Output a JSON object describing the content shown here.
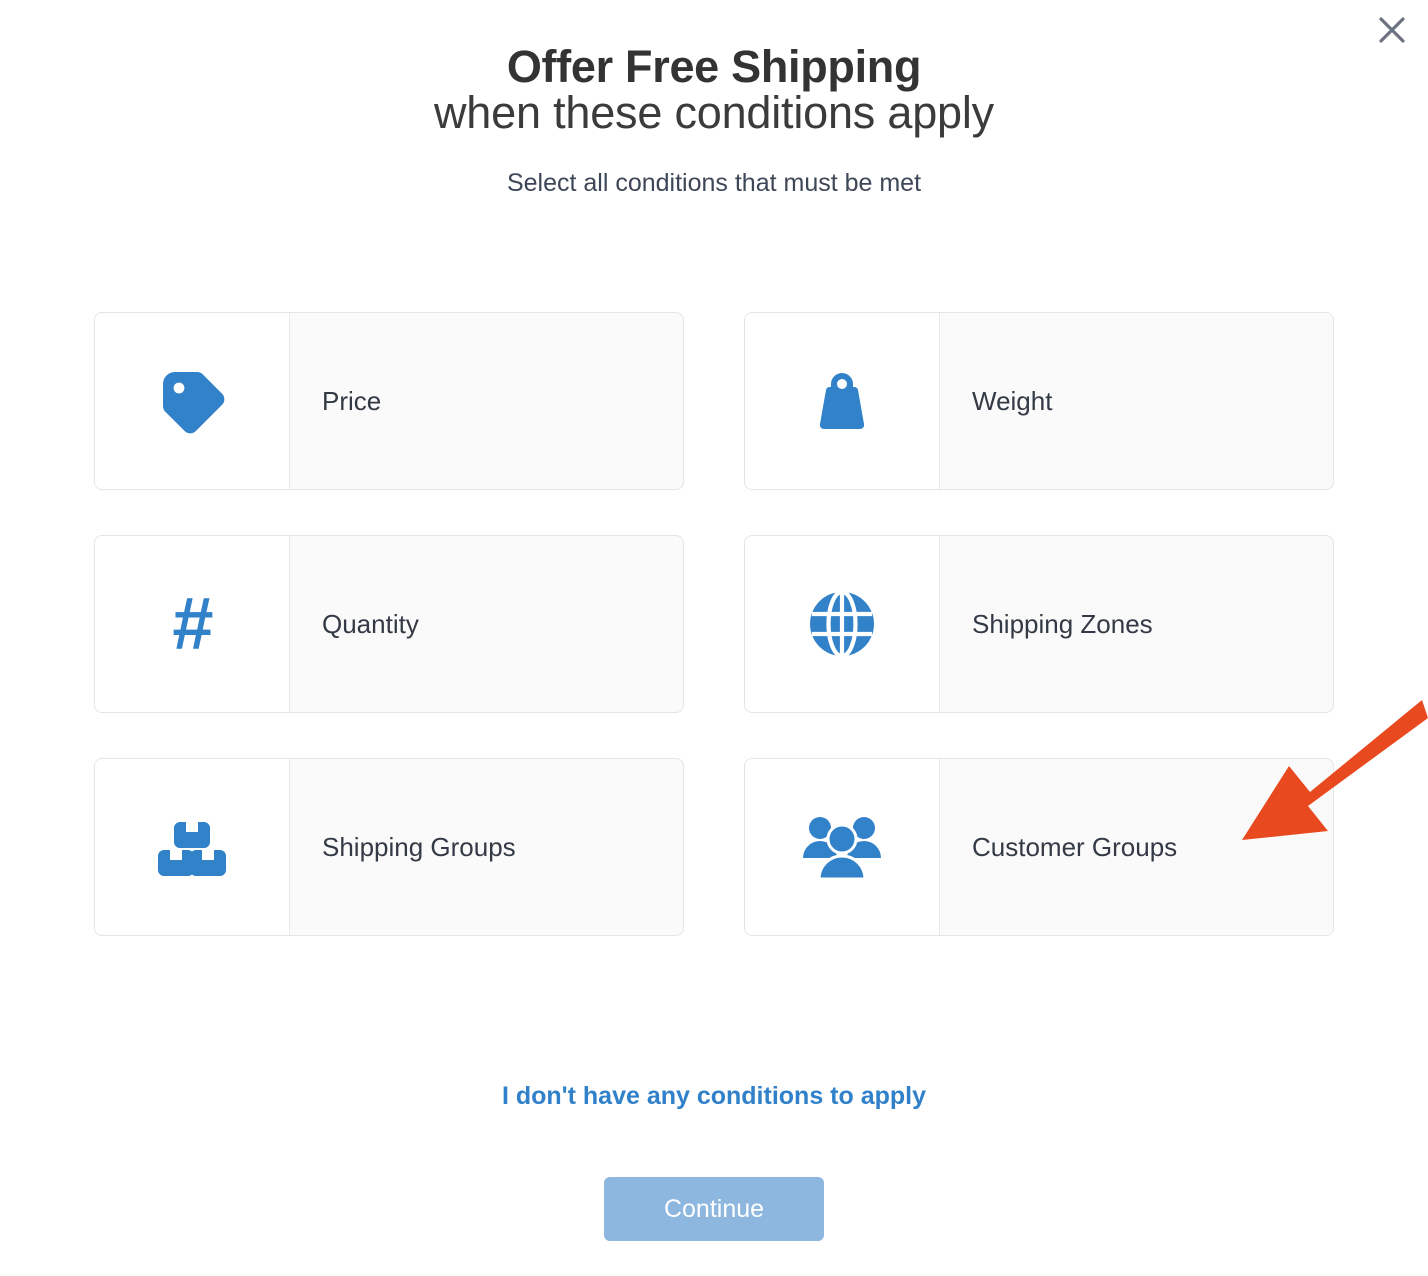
{
  "dialog": {
    "title_line1": "Offer Free Shipping",
    "title_line2": "when these conditions apply",
    "subtitle": "Select all conditions that must be met",
    "close_icon": "close-icon"
  },
  "conditions": [
    {
      "label": "Price",
      "icon": "price-tag-icon"
    },
    {
      "label": "Weight",
      "icon": "weight-icon"
    },
    {
      "label": "Quantity",
      "icon": "hash-icon",
      "glyph": "#"
    },
    {
      "label": "Shipping Zones",
      "icon": "globe-icon"
    },
    {
      "label": "Shipping Groups",
      "icon": "boxes-icon"
    },
    {
      "label": "Customer Groups",
      "icon": "people-group-icon"
    }
  ],
  "footer": {
    "skip_link": "I don't have any conditions to apply",
    "continue_label": "Continue"
  },
  "annotation": {
    "type": "arrow",
    "points_to": "Customer Groups",
    "color": "#e8491f"
  },
  "colors": {
    "icon_blue": "#3282ca",
    "link_blue": "#3081c9",
    "button_blue": "#8db7de",
    "label_text": "#333a45",
    "title_text": "#333333",
    "card_bg": "#fafafa",
    "card_border": "#e3e5e7"
  }
}
